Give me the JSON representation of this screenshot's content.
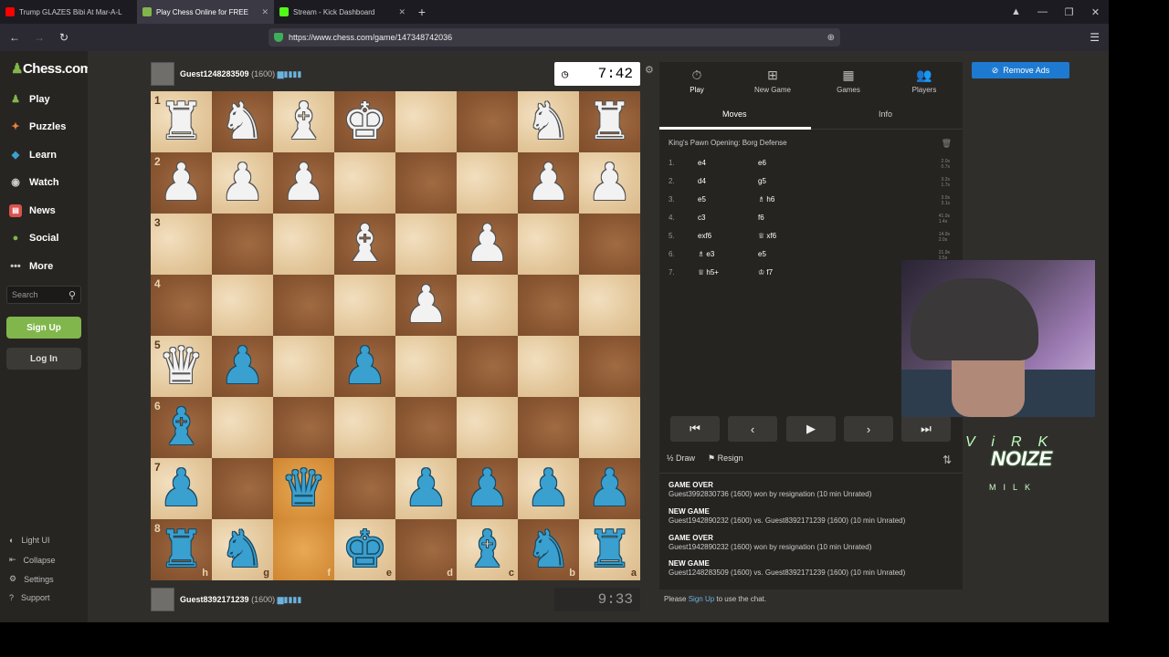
{
  "browser": {
    "tabs": [
      {
        "title": "Trump GLAZES Bibi At Mar-A-L",
        "icon_color": "#ff0000"
      },
      {
        "title": "Play Chess Online for FREE",
        "icon_color": "#81b64c"
      },
      {
        "title": "Stream - Kick Dashboard",
        "icon_color": "#53fc18"
      }
    ],
    "url": "https://www.chess.com/game/147348742036"
  },
  "sidebar": {
    "logo": "Chess.com",
    "nav": [
      "Play",
      "Puzzles",
      "Learn",
      "Watch",
      "News",
      "Social",
      "More"
    ],
    "search_placeholder": "Search",
    "signup": "Sign Up",
    "login": "Log In",
    "bottom": [
      "Light UI",
      "Collapse",
      "Settings",
      "Support"
    ]
  },
  "game": {
    "top_player": {
      "name": "Guest1248283509",
      "rating": "(1600)",
      "clock": "7:42"
    },
    "bottom_player": {
      "name": "Guest8392171239",
      "rating": "(1600)",
      "clock": "9:33"
    },
    "ranks": [
      "1",
      "2",
      "3",
      "4",
      "5",
      "6",
      "7",
      "8"
    ],
    "files": [
      "h",
      "g",
      "f",
      "e",
      "d",
      "c",
      "b",
      "a"
    ],
    "board": [
      [
        "wR",
        "wN",
        "wB",
        "wK",
        "",
        "",
        "wN",
        "wR"
      ],
      [
        "wP",
        "wP",
        "wP",
        "",
        "",
        "",
        "wP",
        "wP"
      ],
      [
        "",
        "",
        "",
        "wB",
        "",
        "wP",
        "",
        ""
      ],
      [
        "",
        "",
        "",
        "",
        "wP",
        "",
        "",
        ""
      ],
      [
        "wQ",
        "bP",
        "",
        "bP",
        "",
        "",
        "",
        ""
      ],
      [
        "bB",
        "",
        "",
        "",
        "",
        "",
        "",
        ""
      ],
      [
        "bP",
        "",
        "bQ",
        "",
        "bP",
        "bP",
        "bP",
        "bP"
      ],
      [
        "bR",
        "bN",
        "",
        "bK",
        "",
        "bB",
        "bN",
        "bR"
      ]
    ],
    "highlighted_squares": [
      "6-2",
      "7-2"
    ]
  },
  "panel": {
    "tabs": [
      "Play",
      "New Game",
      "Games",
      "Players"
    ],
    "subtabs": [
      "Moves",
      "Info"
    ],
    "opening": "King's Pawn Opening: Borg Defense",
    "moves": [
      {
        "n": "1.",
        "w": "e4",
        "b": "e6",
        "times": [
          "2.0s",
          "0.7s"
        ]
      },
      {
        "n": "2.",
        "w": "d4",
        "b": "g5",
        "times": [
          "3.2s",
          "1.7s"
        ]
      },
      {
        "n": "3.",
        "w": "e5",
        "b": "♗ h6",
        "times": [
          "3.0s",
          "3.1s"
        ]
      },
      {
        "n": "4.",
        "w": "c3",
        "b": "f6",
        "times": [
          "41.0s",
          "1.4s"
        ]
      },
      {
        "n": "5.",
        "w": "exf6",
        "b": "♕ xf6",
        "times": [
          "14.9s",
          "2.0s"
        ]
      },
      {
        "n": "6.",
        "w": "♗ e3",
        "b": "e5",
        "times": [
          "21.9s",
          "3.5s"
        ]
      },
      {
        "n": "7.",
        "w": "♕ h5+",
        "b": "♔ f7",
        "times": [
          "",
          ""
        ]
      }
    ],
    "actions": {
      "draw": "Draw",
      "resign": "Resign"
    },
    "chat": [
      {
        "head": "GAME OVER",
        "body": "Guest3992830736 (1600) won by resignation (10 min Unrated)"
      },
      {
        "head": "NEW GAME",
        "body": "Guest1942890232 (1600) vs. Guest8392171239 (1600) (10 min Unrated)"
      },
      {
        "head": "GAME OVER",
        "body": "Guest1942890232 (1600) won by resignation (10 min Unrated)"
      },
      {
        "head": "NEW GAME",
        "body": "Guest1248283509 (1600) vs. Guest8392171239 (1600) (10 min Unrated)"
      }
    ],
    "chat_footer_pre": "Please",
    "chat_footer_link": "Sign Up",
    "chat_footer_post": "to use the chat."
  },
  "remove_ads": "Remove Ads",
  "overlay": {
    "top": "ViRK",
    "big": "NOIZE",
    "small": "MILK"
  }
}
